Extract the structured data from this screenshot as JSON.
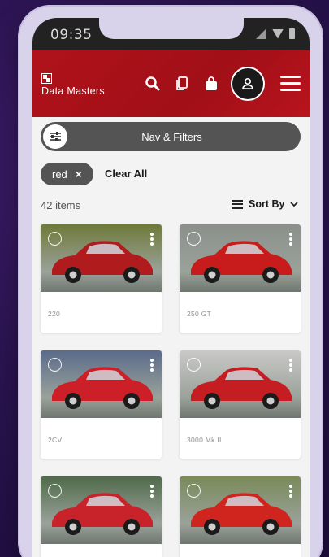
{
  "status": {
    "time": "09:35"
  },
  "app": {
    "brand": "Data Masters"
  },
  "filters": {
    "nav_label": "Nav & Filters",
    "chip": "red",
    "chip_remove": "×",
    "clear_all": "Clear All",
    "count": "42 items",
    "sort_label": "Sort By"
  },
  "items": [
    {
      "name": "220",
      "colors": {
        "bg": "#6e7a3a",
        "car": "#b01c1e"
      }
    },
    {
      "name": "250 GT",
      "colors": {
        "bg": "#8a8f8a",
        "car": "#c81c1c"
      }
    },
    {
      "name": "2CV",
      "colors": {
        "bg": "#5a6b8a",
        "car": "#cc1f27"
      }
    },
    {
      "name": "3000 Mk II",
      "colors": {
        "bg": "#c9c9c6",
        "car": "#c41e22"
      }
    },
    {
      "name": "",
      "colors": {
        "bg": "#4f6a4a",
        "car": "#c8232a"
      }
    },
    {
      "name": "",
      "colors": {
        "bg": "#7a8a5a",
        "car": "#d0251f"
      }
    }
  ],
  "accent": "#b0121a"
}
